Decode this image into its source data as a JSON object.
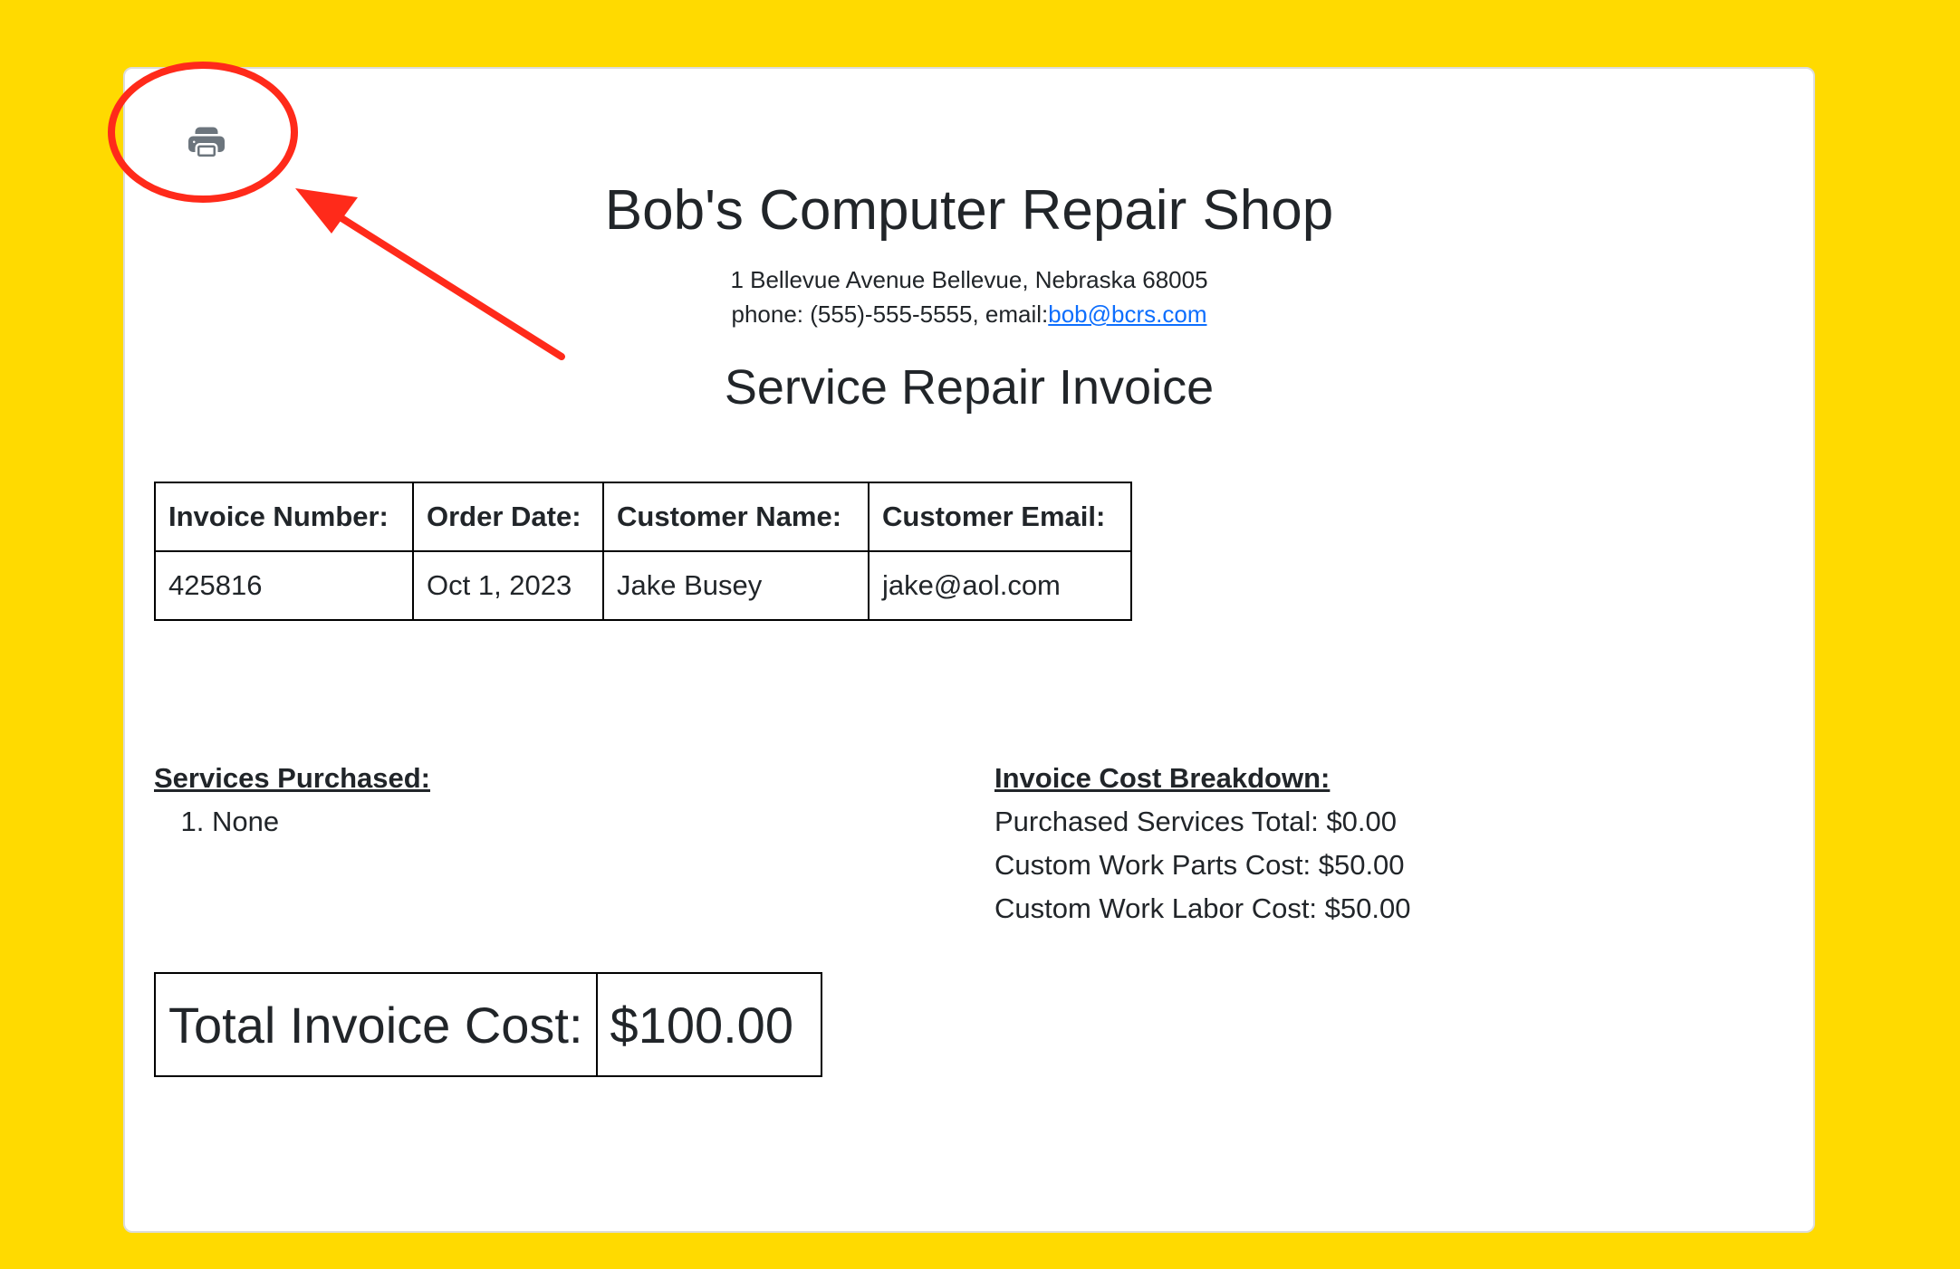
{
  "colors": {
    "page_background": "#FFDA00",
    "annotation": "#FF2A1A",
    "link": "#0d6efd",
    "print_icon": "#6c757d"
  },
  "toolbar": {
    "print_icon": "printer-icon"
  },
  "shop": {
    "name": "Bob's Computer Repair Shop",
    "address": "1 Bellevue Avenue Bellevue, Nebraska 68005",
    "contact_prefix": "phone: (555)-555-5555, email:",
    "email": "bob@bcrs.com"
  },
  "invoice": {
    "title": "Service Repair Invoice",
    "headers": {
      "number": "Invoice Number:",
      "date": "Order Date:",
      "customer_name": "Customer Name:",
      "customer_email": "Customer Email:"
    },
    "values": {
      "number": "425816",
      "date": "Oct 1, 2023",
      "customer_name": "Jake Busey",
      "customer_email": "jake@aol.com"
    }
  },
  "services": {
    "label": "Services Purchased:",
    "items": [
      "None"
    ]
  },
  "breakdown": {
    "label": "Invoice Cost Breakdown:",
    "rows": [
      "Purchased Services Total: $0.00",
      "Custom Work Parts Cost: $50.00",
      "Custom Work Labor Cost: $50.00"
    ]
  },
  "total": {
    "label": "Total Invoice Cost:",
    "value": "$100.00"
  }
}
